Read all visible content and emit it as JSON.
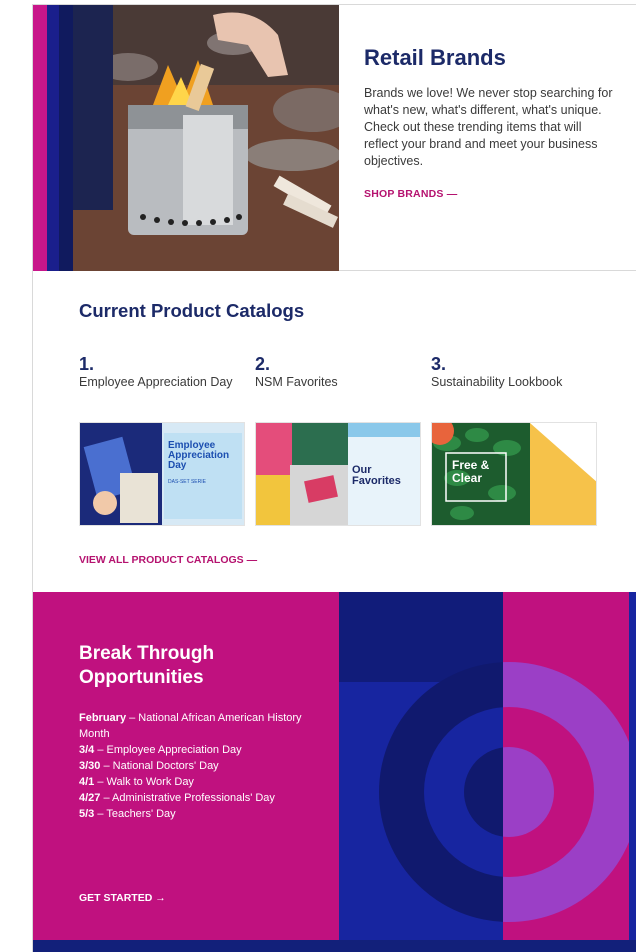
{
  "retail": {
    "title": "Retail Brands",
    "body": "Brands we love! We never stop searching for what's new, what's different, what's unique. Check out these trending items that will reflect your brand and meet your business objectives.",
    "link": "SHOP BRANDS —"
  },
  "catalogs": {
    "heading": "Current Product Catalogs",
    "items": [
      {
        "num": "1.",
        "name": "Employee Appreciation Day",
        "thumb_title": "Employee Appreciation Day",
        "thumb_sub": "DAS-SET SERIE"
      },
      {
        "num": "2.",
        "name": "NSM Favorites",
        "thumb_title": "Our Favorites"
      },
      {
        "num": "3.",
        "name": "Sustainability Lookbook",
        "thumb_title": "Free & Clear"
      }
    ],
    "link": "VIEW ALL PRODUCT CATALOGS —"
  },
  "breakthrough": {
    "title": "Break Through Opportunities",
    "items": [
      {
        "date": "February",
        "text": " – National African American History Month"
      },
      {
        "date": "3/4",
        "text": " – Employee Appreciation Day"
      },
      {
        "date": "3/30",
        "text": " – National Doctors' Day"
      },
      {
        "date": "4/1",
        "text": " – Walk to Work Day"
      },
      {
        "date": "4/27",
        "text": " – Administrative Professionals' Day"
      },
      {
        "date": "5/3",
        "text": " – Teachers' Day"
      }
    ],
    "link": "GET STARTED →"
  },
  "colors": {
    "navy": "#1c2a68",
    "magenta": "#c0117f",
    "link": "#b5126f",
    "royal": "#12207a"
  }
}
